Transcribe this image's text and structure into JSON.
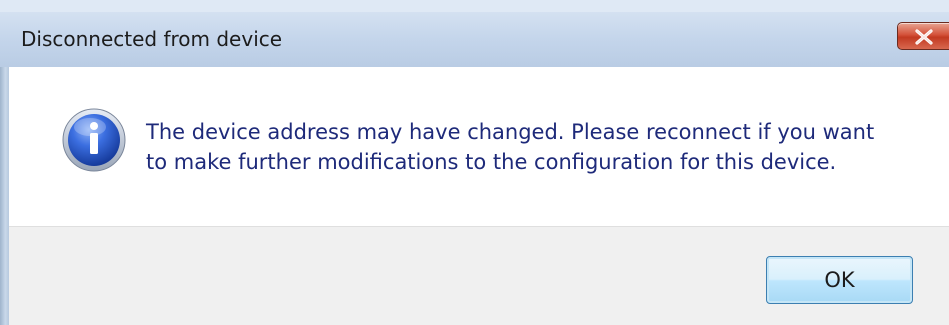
{
  "window": {
    "title": "Disconnected from device"
  },
  "icon": {
    "name": "info-icon",
    "color": "#2a5bd7"
  },
  "message": {
    "line1": "The device address may have changed. Please reconnect if you want",
    "line2": "to make further modifications to the configuration for this device."
  },
  "buttons": {
    "ok_label": "OK",
    "close_icon": "close-icon"
  },
  "colors": {
    "message_text": "#1e2a7a",
    "close_button": "#c8452c",
    "ok_border": "#3c7fb1"
  }
}
